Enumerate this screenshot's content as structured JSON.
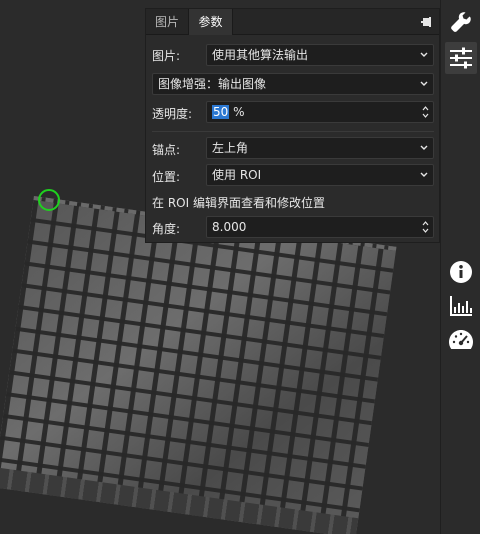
{
  "panel": {
    "tabs": [
      {
        "label": "图片",
        "active": false
      },
      {
        "label": "参数",
        "active": true
      }
    ],
    "image_label": "图片:",
    "image_value": "使用其他算法输出",
    "enhance_value": "图像增强：输出图像",
    "opacity_label": "透明度:",
    "opacity_number": "50",
    "opacity_unit": " %",
    "anchor_label": "锚点:",
    "anchor_value": "左上角",
    "position_label": "位置:",
    "position_value": "使用 ROI",
    "roi_hint": "在 ROI 编辑界面查看和修改位置",
    "angle_label": "角度:",
    "angle_value": "8.000"
  },
  "toolbar": {
    "icons": [
      "wrench-icon",
      "sliders-icon",
      "info-icon",
      "histogram-icon",
      "speedometer-icon"
    ],
    "active": "sliders-icon"
  },
  "colors": {
    "accent": "#2b78d2",
    "anchor_marker": "#1fd11f",
    "background": "#2b2b2b"
  }
}
